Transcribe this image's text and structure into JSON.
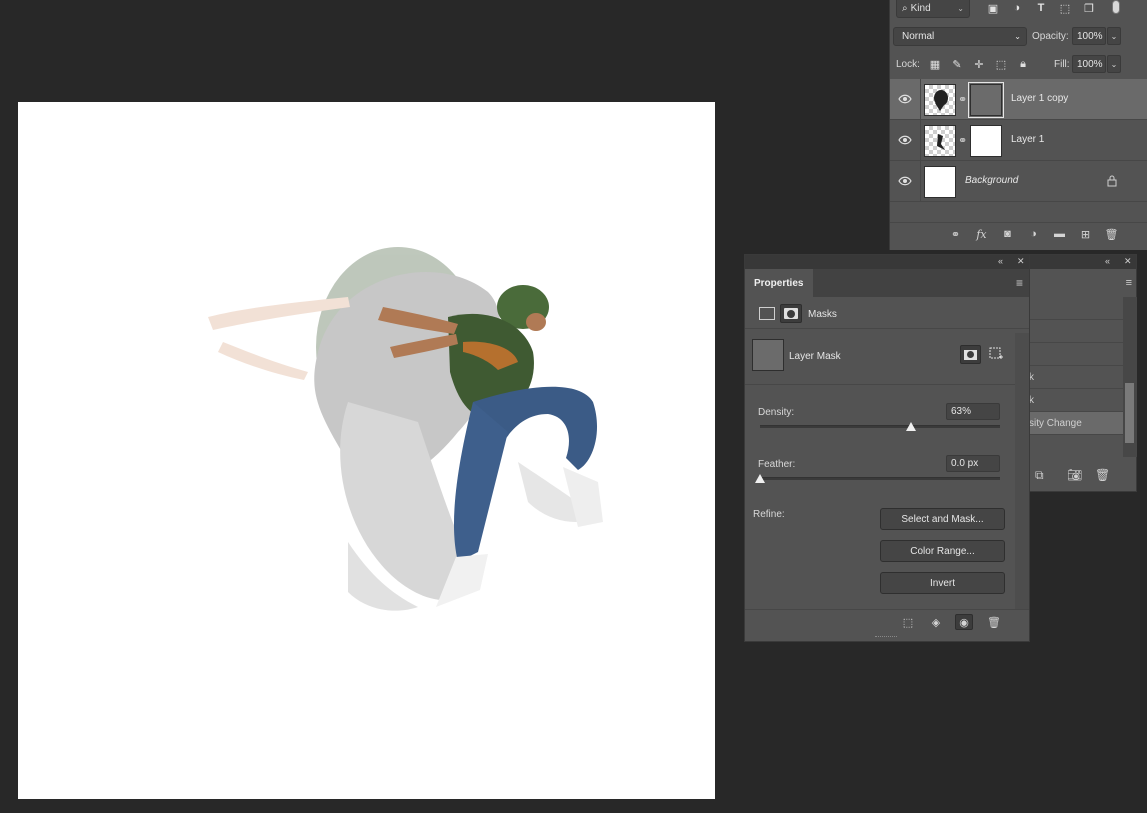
{
  "layers_panel": {
    "filter_kind": "Kind",
    "filter_icons": [
      "image-filter-icon",
      "adjustment-filter-icon",
      "type-filter-icon",
      "shape-filter-icon",
      "smart-object-filter-icon"
    ],
    "blend_mode": "Normal",
    "opacity_label": "Opacity:",
    "opacity_value": "100%",
    "lock_label": "Lock:",
    "fill_label": "Fill:",
    "fill_value": "100%",
    "layers": [
      {
        "name": "Layer 1 copy",
        "selected": true,
        "has_mask": true
      },
      {
        "name": "Layer 1",
        "selected": false,
        "has_mask": true
      },
      {
        "name": "Background",
        "selected": false,
        "locked": true
      }
    ],
    "footer_icons": [
      "link-layers-icon",
      "fx-icon",
      "add-mask-icon",
      "adjustment-layer-icon",
      "group-icon",
      "new-layer-icon",
      "delete-icon"
    ]
  },
  "history_panel": {
    "rows": [
      "",
      "",
      "",
      "k",
      "k",
      "sity Change"
    ],
    "active_row": "sity Change"
  },
  "properties": {
    "tab": "Properties",
    "section": "Masks",
    "mask_label": "Layer Mask",
    "density_label": "Density:",
    "density_value": "63%",
    "density_level": 0.63,
    "feather_label": "Feather:",
    "feather_value": "0.0 px",
    "feather_level": 0.0,
    "refine_label": "Refine:",
    "buttons": {
      "select_and_mask": "Select and Mask...",
      "color_range": "Color Range...",
      "invert": "Invert"
    }
  },
  "colors": {
    "app_bg": "#282828",
    "panel_bg": "#535353",
    "selected_row": "#6a6a6a",
    "mask_gray": "#6b6b6b"
  }
}
